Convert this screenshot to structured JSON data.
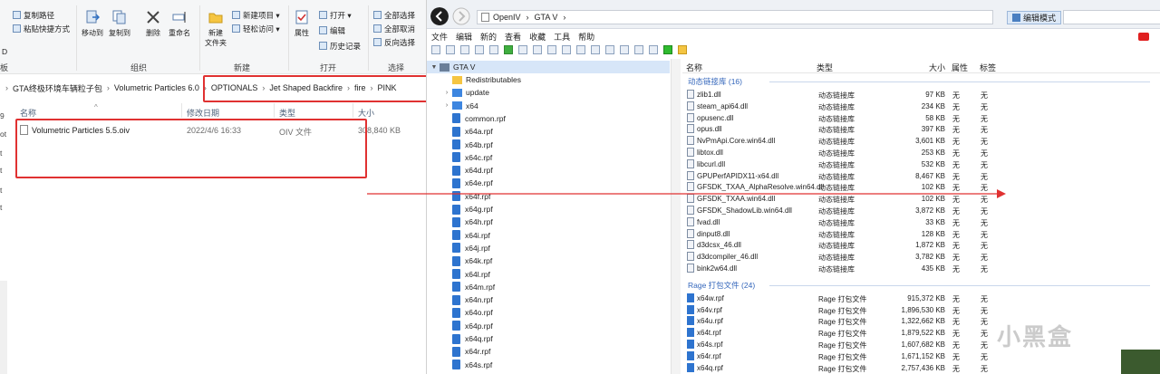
{
  "explorer": {
    "ribbon": {
      "copy_path": "复制路径",
      "paste_shortcut": "粘贴快捷方式",
      "move_to": "移动到",
      "copy_to": "复制到",
      "delete": "删除",
      "rename": "重命名",
      "new_folder_line1": "新建",
      "new_folder_line2": "文件夹",
      "new_item": "新建项目 ▾",
      "easy_access": "轻松访问 ▾",
      "properties": "属性",
      "open": "打开 ▾",
      "edit": "编辑",
      "history": "历史记录",
      "select_all": "全部选择",
      "select_none": "全部取消",
      "invert": "反向选择",
      "group_organize": "组织",
      "group_new": "新建",
      "group_open": "打开",
      "group_select": "选择",
      "side_b": "板",
      "side_d": "D"
    },
    "breadcrumb": [
      "GTA终极环境车辆粒子包",
      "Volumetric Particles 6.0",
      "OPTIONALS",
      "Jet Shaped Backfire",
      "fire",
      "PINK"
    ],
    "breadcrumb_sep": "›",
    "columns": {
      "name": "名称",
      "date": "修改日期",
      "type": "类型",
      "size": "大小"
    },
    "file": {
      "name": "Volumetric Particles 5.5.oiv",
      "date": "2022/4/6 16:33",
      "type": "OIV 文件",
      "size": "308,840 KB"
    },
    "left_letters": [
      "9",
      "ot",
      "t",
      "t",
      "t",
      "t"
    ]
  },
  "openiv": {
    "path": [
      "OpenIV",
      "GTA V"
    ],
    "path_sep": "›",
    "edit_mode": "编辑模式",
    "menu": [
      "文件",
      "编辑",
      "新的",
      "查看",
      "收藏",
      "工具",
      "帮助"
    ],
    "tree": {
      "root": "GTA V",
      "items": [
        {
          "name": "Redistributables",
          "kind": "folder"
        },
        {
          "name": "update",
          "kind": "folder-blue"
        },
        {
          "name": "x64",
          "kind": "folder-blue"
        },
        {
          "name": "common.rpf",
          "kind": "rpf"
        },
        {
          "name": "x64a.rpf",
          "kind": "rpf"
        },
        {
          "name": "x64b.rpf",
          "kind": "rpf"
        },
        {
          "name": "x64c.rpf",
          "kind": "rpf"
        },
        {
          "name": "x64d.rpf",
          "kind": "rpf"
        },
        {
          "name": "x64e.rpf",
          "kind": "rpf"
        },
        {
          "name": "x64f.rpf",
          "kind": "rpf"
        },
        {
          "name": "x64g.rpf",
          "kind": "rpf"
        },
        {
          "name": "x64h.rpf",
          "kind": "rpf"
        },
        {
          "name": "x64i.rpf",
          "kind": "rpf"
        },
        {
          "name": "x64j.rpf",
          "kind": "rpf"
        },
        {
          "name": "x64k.rpf",
          "kind": "rpf"
        },
        {
          "name": "x64l.rpf",
          "kind": "rpf"
        },
        {
          "name": "x64m.rpf",
          "kind": "rpf"
        },
        {
          "name": "x64n.rpf",
          "kind": "rpf"
        },
        {
          "name": "x64o.rpf",
          "kind": "rpf"
        },
        {
          "name": "x64p.rpf",
          "kind": "rpf"
        },
        {
          "name": "x64q.rpf",
          "kind": "rpf"
        },
        {
          "name": "x64r.rpf",
          "kind": "rpf"
        },
        {
          "name": "x64s.rpf",
          "kind": "rpf"
        }
      ]
    },
    "list": {
      "columns": {
        "name": "名称",
        "type": "类型",
        "size": "大小",
        "attr": "属性",
        "tag": "标签"
      },
      "dll_group": "动态链接库 (16)",
      "dll_rows": [
        {
          "name": "zlib1.dll",
          "type": "动态链接库",
          "size": "97 KB",
          "attr": "无",
          "tag": "无"
        },
        {
          "name": "steam_api64.dll",
          "type": "动态链接库",
          "size": "234 KB",
          "attr": "无",
          "tag": "无"
        },
        {
          "name": "opusenc.dll",
          "type": "动态链接库",
          "size": "58 KB",
          "attr": "无",
          "tag": "无"
        },
        {
          "name": "opus.dll",
          "type": "动态链接库",
          "size": "397 KB",
          "attr": "无",
          "tag": "无"
        },
        {
          "name": "NvPmApi.Core.win64.dll",
          "type": "动态链接库",
          "size": "3,601 KB",
          "attr": "无",
          "tag": "无"
        },
        {
          "name": "libtox.dll",
          "type": "动态链接库",
          "size": "253 KB",
          "attr": "无",
          "tag": "无"
        },
        {
          "name": "libcurl.dll",
          "type": "动态链接库",
          "size": "532 KB",
          "attr": "无",
          "tag": "无"
        },
        {
          "name": "GPUPerfAPIDX11-x64.dll",
          "type": "动态链接库",
          "size": "8,467 KB",
          "attr": "无",
          "tag": "无"
        },
        {
          "name": "GFSDK_TXAA_AlphaResolve.win64.dll",
          "type": "动态链接库",
          "size": "102 KB",
          "attr": "无",
          "tag": "无"
        },
        {
          "name": "GFSDK_TXAA.win64.dll",
          "type": "动态链接库",
          "size": "102 KB",
          "attr": "无",
          "tag": "无"
        },
        {
          "name": "GFSDK_ShadowLib.win64.dll",
          "type": "动态链接库",
          "size": "3,872 KB",
          "attr": "无",
          "tag": "无"
        },
        {
          "name": "fvad.dll",
          "type": "动态链接库",
          "size": "33 KB",
          "attr": "无",
          "tag": "无"
        },
        {
          "name": "dinput8.dll",
          "type": "动态链接库",
          "size": "128 KB",
          "attr": "无",
          "tag": "无"
        },
        {
          "name": "d3dcsx_46.dll",
          "type": "动态链接库",
          "size": "1,872 KB",
          "attr": "无",
          "tag": "无"
        },
        {
          "name": "d3dcompiler_46.dll",
          "type": "动态链接库",
          "size": "3,782 KB",
          "attr": "无",
          "tag": "无"
        },
        {
          "name": "bink2w64.dll",
          "type": "动态链接库",
          "size": "435 KB",
          "attr": "无",
          "tag": "无"
        }
      ],
      "rpf_group": "Rage 打包文件 (24)",
      "rpf_rows": [
        {
          "name": "x64w.rpf",
          "type": "Rage 打包文件",
          "size": "915,372 KB",
          "attr": "无",
          "tag": "无"
        },
        {
          "name": "x64v.rpf",
          "type": "Rage 打包文件",
          "size": "1,896,530 KB",
          "attr": "无",
          "tag": "无"
        },
        {
          "name": "x64u.rpf",
          "type": "Rage 打包文件",
          "size": "1,322,662 KB",
          "attr": "无",
          "tag": "无"
        },
        {
          "name": "x64t.rpf",
          "type": "Rage 打包文件",
          "size": "1,879,522 KB",
          "attr": "无",
          "tag": "无"
        },
        {
          "name": "x64s.rpf",
          "type": "Rage 打包文件",
          "size": "1,607,682 KB",
          "attr": "无",
          "tag": "无"
        },
        {
          "name": "x64r.rpf",
          "type": "Rage 打包文件",
          "size": "1,671,152 KB",
          "attr": "无",
          "tag": "无"
        },
        {
          "name": "x64q.rpf",
          "type": "Rage 打包文件",
          "size": "2,757,436 KB",
          "attr": "无",
          "tag": "无"
        }
      ]
    }
  },
  "watermark": "小黑盒",
  "colors": {
    "accent": "#2e74cf",
    "highlight_red": "#e03131",
    "group_blue": "#3366bb"
  }
}
